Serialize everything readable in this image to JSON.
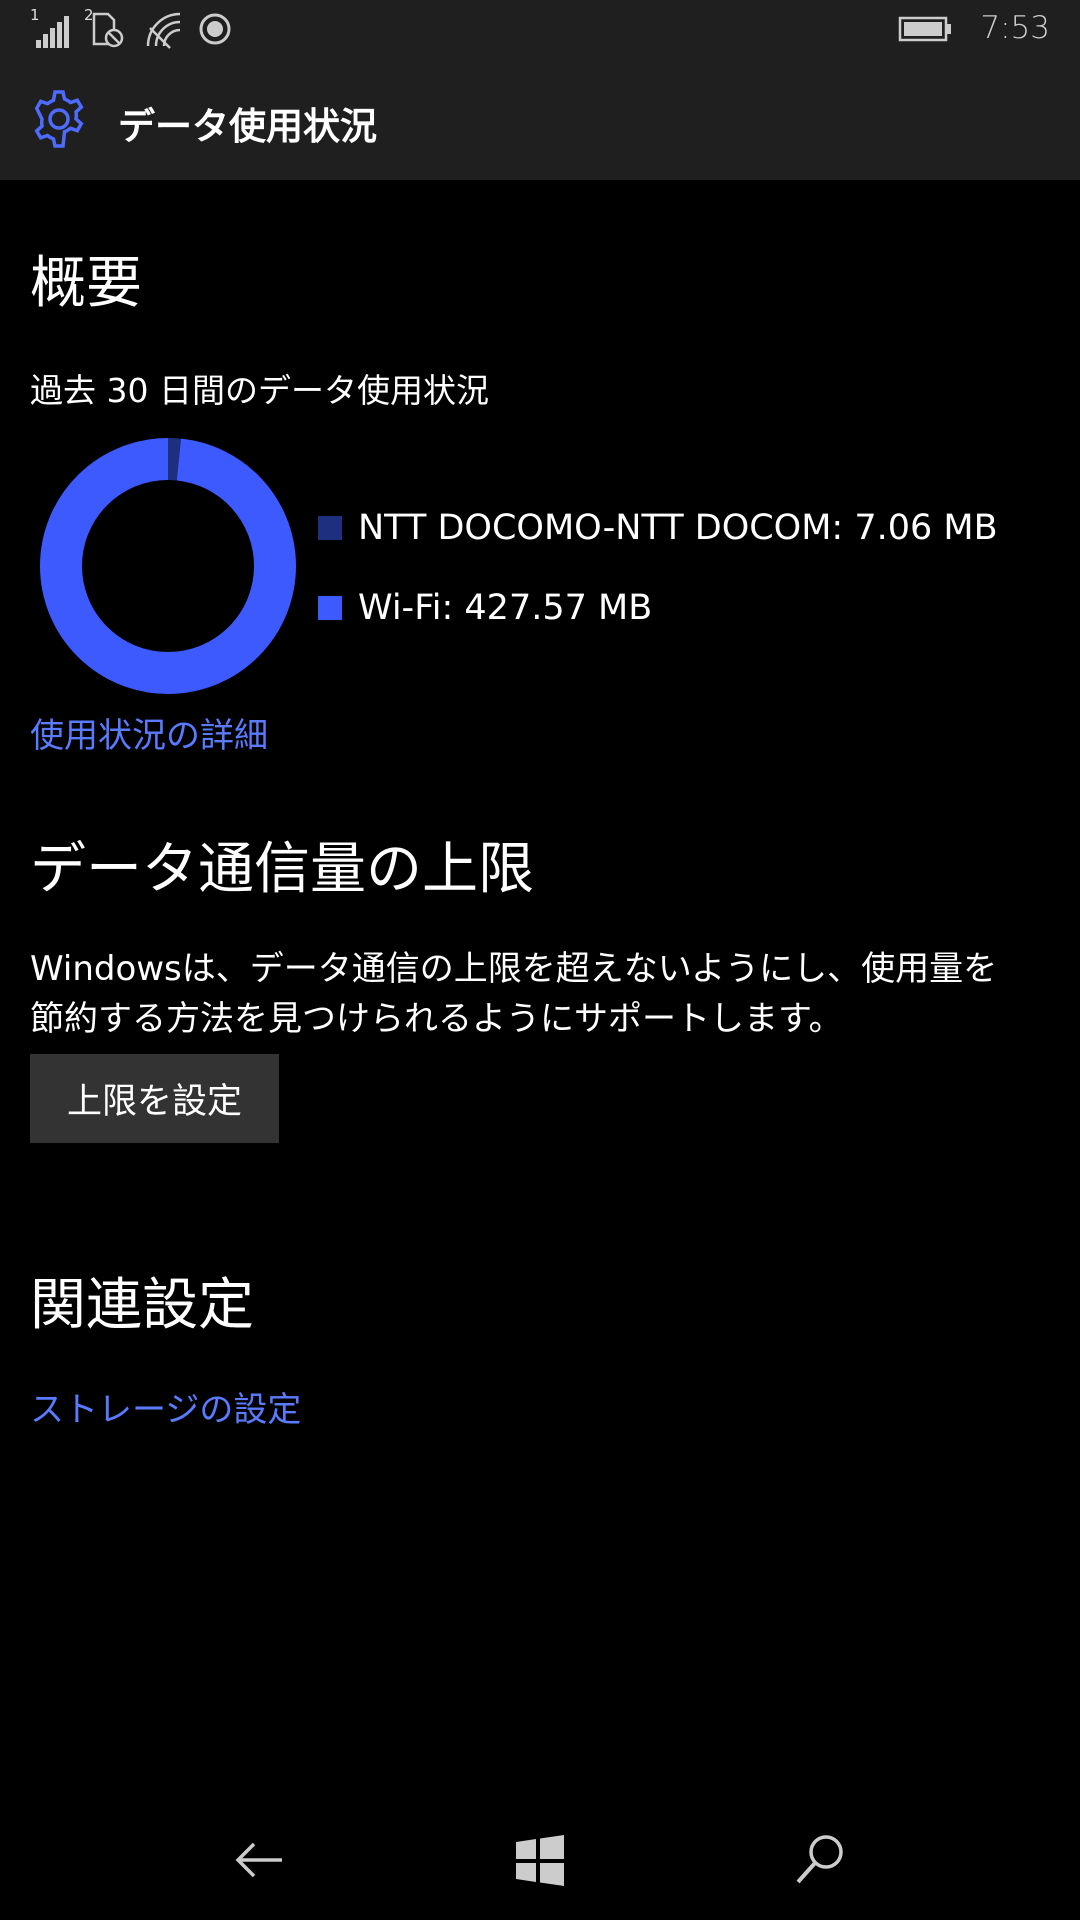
{
  "status_bar": {
    "sim1_label": "1",
    "sim2_label": "2",
    "time": "7:53",
    "icons": [
      "signal-icon",
      "sim-no-data-icon",
      "wifi-icon",
      "location-icon",
      "battery-icon"
    ]
  },
  "header": {
    "title": "データ使用状況",
    "icon": "gear-icon"
  },
  "overview": {
    "heading": "概要",
    "subtitle": "過去 30 日間のデータ使用状況",
    "details_link": "使用状況の詳細"
  },
  "chart_data": {
    "type": "pie",
    "style": "donut",
    "categories": [
      "NTT DOCOMO-NTT DOCOM",
      "Wi-Fi"
    ],
    "values": [
      7.06,
      427.57
    ],
    "unit": "MB",
    "colors": [
      "#1f2f80",
      "#3d5afe"
    ],
    "legend": [
      {
        "label": "NTT DOCOMO-NTT DOCOM: 7.06 MB",
        "color": "#1f2f80"
      },
      {
        "label": "Wi-Fi: 427.57 MB",
        "color": "#3d5afe"
      }
    ]
  },
  "limit": {
    "heading": "データ通信量の上限",
    "description": "Windowsは、データ通信の上限を超えないようにし、使用量を節約する方法を見つけられるようにサポートします。",
    "button_label": "上限を設定"
  },
  "related": {
    "heading": "関連設定",
    "storage_link": "ストレージの設定"
  },
  "nav": {
    "icons": [
      "back-icon",
      "windows-start-icon",
      "search-icon"
    ]
  },
  "colors": {
    "accent": "#5a7bff",
    "chrome": "#1f1f1f",
    "background": "#000000"
  }
}
